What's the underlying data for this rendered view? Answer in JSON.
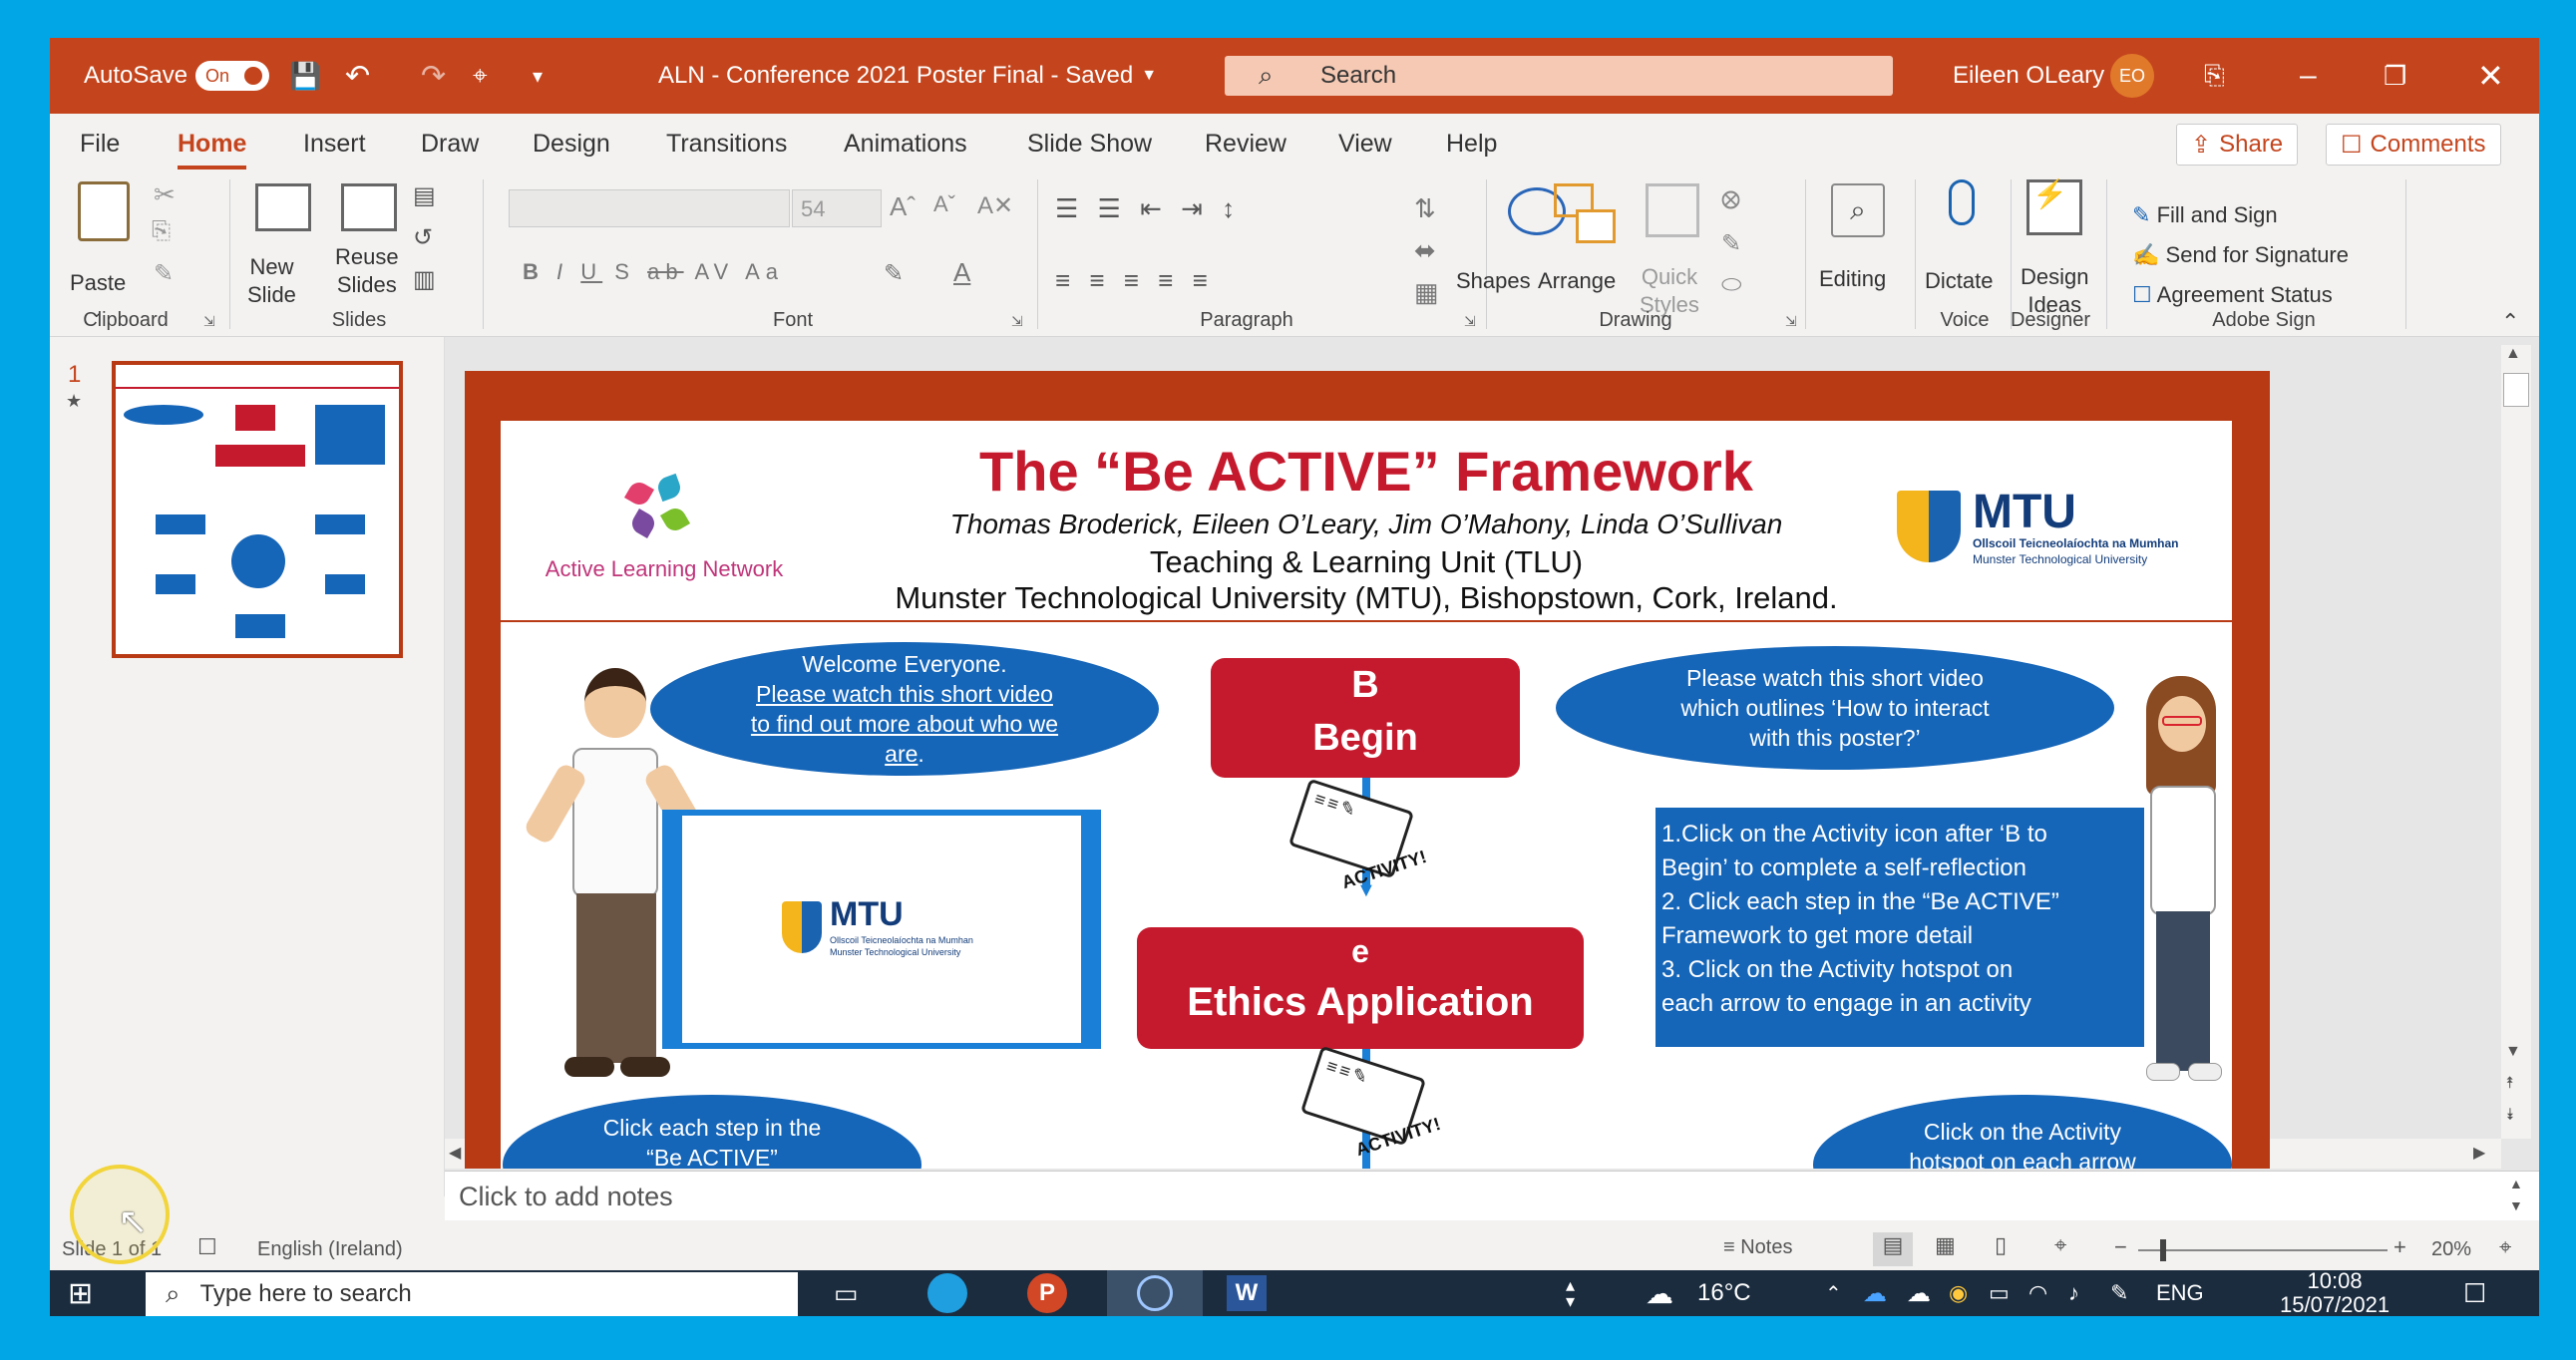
{
  "titlebar": {
    "autosave_label": "AutoSave",
    "autosave_state": "On",
    "doc_title": "ALN - Conference 2021 Poster Final  -  Saved",
    "search_placeholder": "Search",
    "user_name": "Eileen OLeary",
    "user_initials": "EO"
  },
  "menu": {
    "items": [
      "File",
      "Home",
      "Insert",
      "Draw",
      "Design",
      "Transitions",
      "Animations",
      "Slide Show",
      "Review",
      "View",
      "Help"
    ],
    "active": "Home",
    "share_label": "Share",
    "comments_label": "Comments"
  },
  "ribbon": {
    "clipboard": {
      "paste": "Paste",
      "group": "Clipboard"
    },
    "slides": {
      "new_slide": "New\nSlide",
      "reuse_slides": "Reuse\nSlides",
      "group": "Slides"
    },
    "font": {
      "size_value": "54",
      "bold": "B",
      "italic": "I",
      "underline": "U",
      "shadow": "S",
      "strike": "ab",
      "spacing": "AV",
      "case": "Aa",
      "group": "Font"
    },
    "paragraph": {
      "group": "Paragraph"
    },
    "drawing": {
      "shapes": "Shapes",
      "arrange": "Arrange",
      "quick_styles": "Quick\nStyles",
      "group": "Drawing"
    },
    "editing": {
      "label": "Editing"
    },
    "voice": {
      "dictate": "Dictate",
      "group": "Voice"
    },
    "designer": {
      "design_ideas": "Design\nIdeas",
      "group": "Designer"
    },
    "adobe": {
      "fill_sign": "Fill and Sign",
      "send_sig": "Send for Signature",
      "agreement": "Agreement Status",
      "group": "Adobe Sign"
    }
  },
  "thumbnail": {
    "number": "1",
    "star": "★"
  },
  "slide": {
    "title": "The “Be ACTIVE” Framework",
    "authors": "Thomas Broderick, Eileen O’Leary, Jim O’Mahony, Linda O’Sullivan",
    "unit": "Teaching & Learning Unit (TLU)",
    "university": "Munster Technological University (MTU), Bishopstown, Cork, Ireland.",
    "aln_label": "Active Learning Network",
    "mtu_logo": "MTU",
    "mtu_sub1": "Ollscoil Teicneolaíochta na Mumhan",
    "mtu_sub2": "Munster Technological University",
    "bubble_welcome_line1": "Welcome Everyone.",
    "bubble_welcome_line2": "Please watch this short video",
    "bubble_welcome_line3": "to find out more about who we",
    "bubble_welcome_line4": "are",
    "bubble_right_line1": "Please watch this short video",
    "bubble_right_line2": "which outlines ‘How to interact",
    "bubble_right_line3": "with this poster?’",
    "step_b_letter": "B",
    "step_b_label": "Begin",
    "step_e_letter": "e",
    "step_e_label": "Ethics Application",
    "activity_label": "ACTIVITY!",
    "instructions": [
      "1.Click on the Activity icon after ‘B to",
      "Begin’ to complete a self-reflection",
      "2. Click each step in the “Be ACTIVE”",
      "Framework to get more detail",
      "3. Click on the  Activity hotspot on",
      "each arrow to engage in an activity"
    ],
    "bubble_bottom_left_1": "Click each step in the",
    "bubble_bottom_left_2": "“Be ACTIVE”",
    "bubble_bottom_right_1": "Click on the  Activity",
    "bubble_bottom_right_2": "hotspot on each arrow"
  },
  "notes_placeholder": "Click to add notes",
  "statusbar": {
    "slide_info": "Slide 1 of 1",
    "language": "English (Ireland)",
    "notes_label": "Notes",
    "zoom": "20%",
    "zoom_fraction": 0.2
  },
  "taskbar": {
    "search_placeholder": "Type here to search",
    "weather": "16°C",
    "language": "ENG",
    "time": "10:08",
    "date": "15/07/2021"
  },
  "colors": {
    "title_bar": "#c4451d",
    "slide_border": "#b83a14",
    "poster_red": "#c51a2d",
    "poster_blue": "#1565b8",
    "desktop": "#00a6e6"
  }
}
